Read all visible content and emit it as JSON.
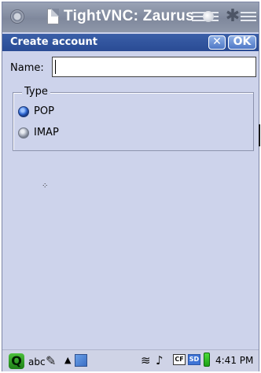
{
  "window": {
    "title": "TightVNC: Zaurus"
  },
  "dialog": {
    "title": "Create account",
    "close_label": "✕",
    "ok_label": "OK"
  },
  "form": {
    "name_label": "Name:",
    "name_value": "",
    "type_legend": "Type",
    "options": [
      {
        "label": "POP",
        "selected": true
      },
      {
        "label": "IMAP",
        "selected": false
      }
    ]
  },
  "taskbar": {
    "input_mode_label": "abc",
    "clock": "4:41 PM",
    "cf_label": "CF",
    "sd_label": "SD",
    "launcher_label": "Q"
  },
  "icons": {
    "window_menu": "window-menu-icon",
    "document": "document-icon",
    "settings": "gear-icon",
    "pen": "pen-icon",
    "wireless": "wifi-icon",
    "volume": "speaker-icon",
    "battery": "battery-icon"
  }
}
